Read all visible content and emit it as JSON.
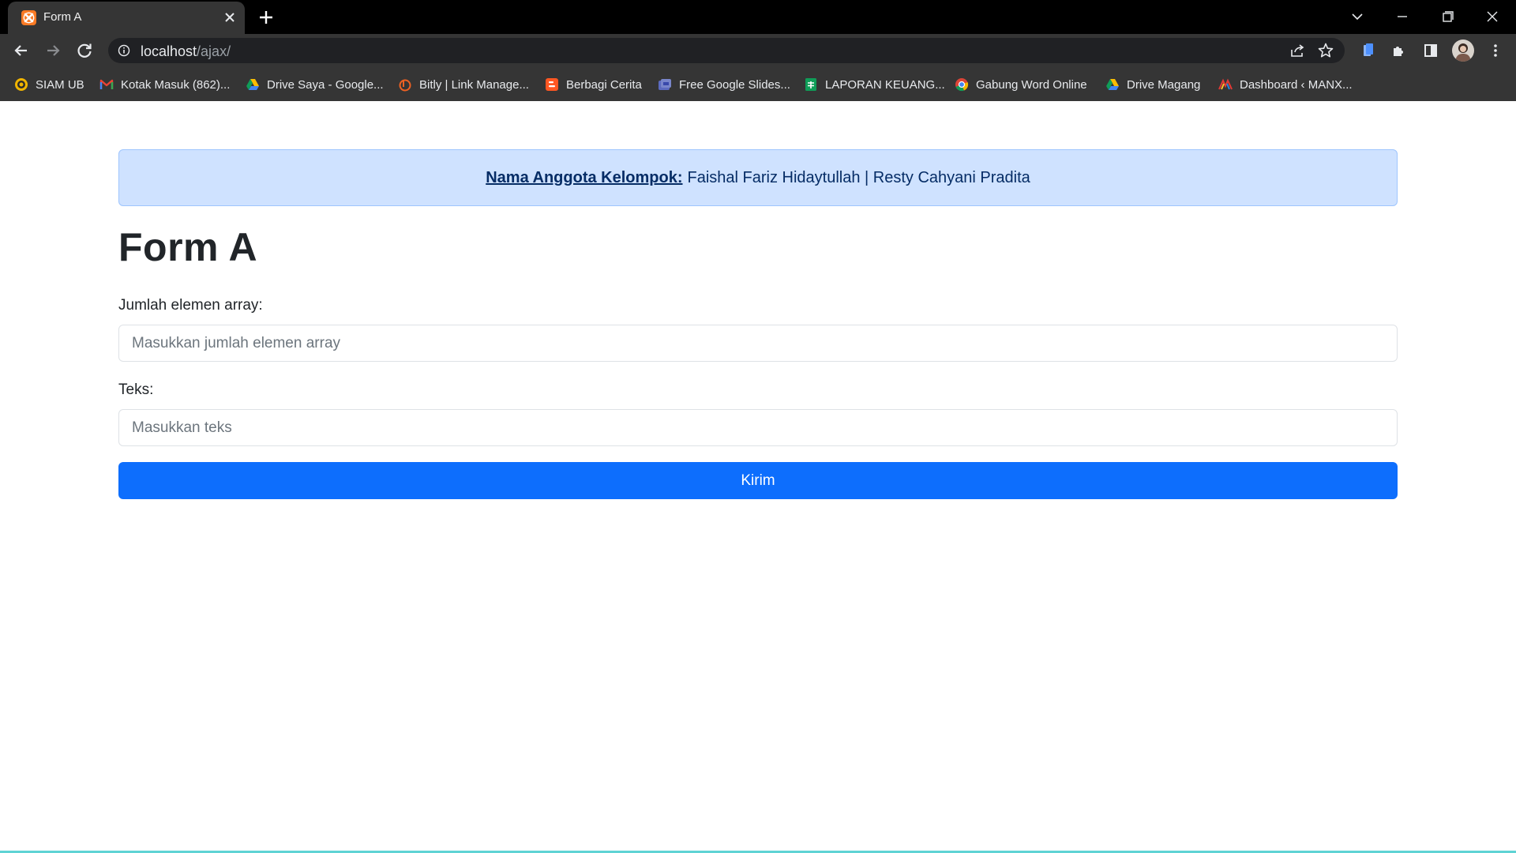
{
  "browser": {
    "tab_title": "Form A",
    "url_host": "localhost",
    "url_path": "/ajax/",
    "colors": {
      "frame": "#000000",
      "toolbar": "#353535",
      "omnibox": "#202124"
    }
  },
  "bookmarks": [
    {
      "label": "SIAM UB",
      "icon": "siam-ub-icon"
    },
    {
      "label": "Kotak Masuk (862)...",
      "icon": "gmail-icon"
    },
    {
      "label": "Drive Saya - Google...",
      "icon": "google-drive-icon"
    },
    {
      "label": "Bitly | Link Manage...",
      "icon": "bitly-icon"
    },
    {
      "label": "Berbagi Cerita",
      "icon": "blogger-icon"
    },
    {
      "label": "Free Google Slides...",
      "icon": "slides-icon"
    },
    {
      "label": "LAPORAN KEUANG...",
      "icon": "google-sheets-icon"
    },
    {
      "label": "Gabung Word Online",
      "icon": "chrome-icon"
    },
    {
      "label": "Drive Magang",
      "icon": "google-drive-icon"
    },
    {
      "label": "Dashboard ‹ MANX...",
      "icon": "manx-icon"
    }
  ],
  "page": {
    "alert_label": "Nama Anggota Kelompok:",
    "alert_text": "Faishal Fariz Hidaytullah | Resty Cahyani Pradita",
    "title": "Form A",
    "array_label": "Jumlah elemen array:",
    "array_placeholder": "Masukkan jumlah elemen array",
    "text_label": "Teks:",
    "text_placeholder": "Masukkan teks",
    "submit_label": "Kirim",
    "colors": {
      "primary": "#0d6efd",
      "alert_bg": "#cfe2ff",
      "alert_text": "#052c65"
    }
  }
}
